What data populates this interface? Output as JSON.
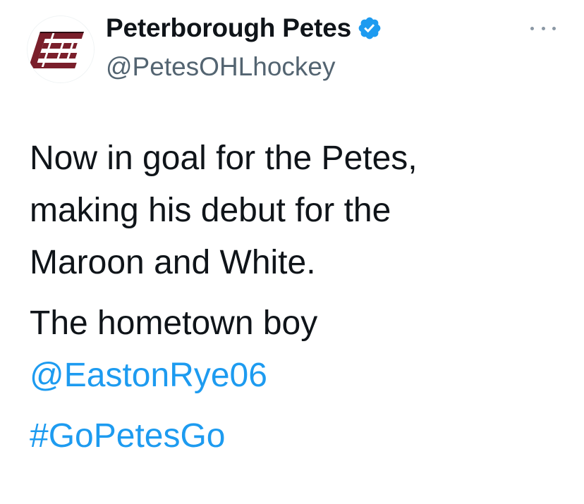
{
  "tweet": {
    "display_name": "Peterborough Petes",
    "handle": "@PetesOHLhockey",
    "verified_icon": "verified-badge-icon",
    "more_icon": "more-options-icon",
    "avatar_logo_text": "Petes",
    "paragraphs": {
      "p1": {
        "line1": "Now in goal for the Petes,",
        "line2": "making his debut for the",
        "line3": "Maroon and White."
      },
      "p2": {
        "text": "The hometown boy",
        "mention": "@EastonRye06"
      },
      "p3": {
        "hashtag": "#GoPetesGo"
      }
    }
  },
  "colors": {
    "text": "#0f1419",
    "secondary": "#536471",
    "link": "#1d9bf0",
    "verified": "#1d9bf0",
    "brand_maroon": "#7a1f2b"
  }
}
